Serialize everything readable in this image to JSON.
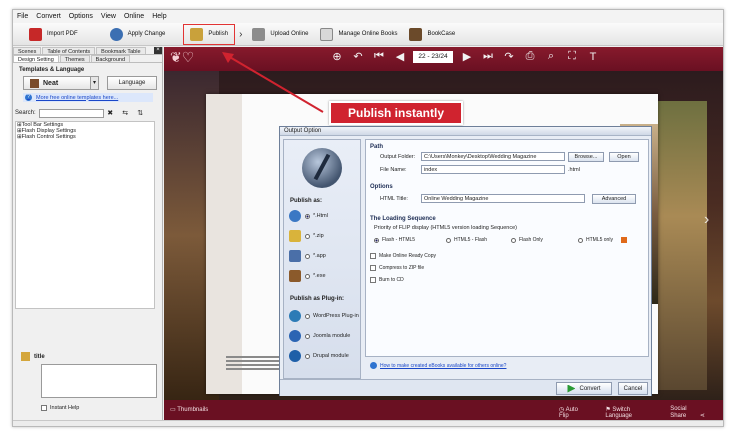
{
  "menu": [
    "File",
    "Convert",
    "Options",
    "View",
    "Online",
    "Help"
  ],
  "toolbar": {
    "import_pdf": "Import PDF",
    "apply_change": "Apply Change",
    "publish": "Publish",
    "upload_online": "Upload Online",
    "manage_online_books": "Manage Online Books",
    "bookcase": "BookCase"
  },
  "left_panel": {
    "tabs_top": [
      "Scenes",
      "Table of Contents",
      "Bookmark Table"
    ],
    "tabs_bottom": [
      "Design Setting",
      "Themes",
      "Background"
    ],
    "section_title": "Templates & Language",
    "template_name": "Neat",
    "language_button": "Language",
    "more_templates_link": "More free online templates here...",
    "search_label": "Search:",
    "settings": [
      "Tool Bar Settings",
      "Flash Display Settings",
      "Flash Control Settings"
    ],
    "help_title": "title",
    "instant_help_label": "Instant Help"
  },
  "viewer": {
    "page_indicator": "22 - 23/24",
    "thumbnails_label": "Thumbnails",
    "auto_flip_label": "Auto Flip",
    "switch_language_label": "Switch Language",
    "social_share_label": "Social Share"
  },
  "dialog": {
    "title": "Output Option",
    "publish_as_heading": "Publish as:",
    "publish_as_options": [
      "*.Html",
      "*.zip",
      "*.app",
      "*.exe"
    ],
    "plugin_heading": "Publish as Plug-in:",
    "plugin_options": [
      "WordPress Plug-in",
      "Joomla module",
      "Drupal module"
    ],
    "path_heading": "Path",
    "output_folder_label": "Output Folder:",
    "output_folder_value": "C:\\Users\\Monkey\\Desktop\\Wedding Magazine",
    "browse_button": "Browse...",
    "open_button": "Open",
    "file_name_label": "File Name:",
    "file_name_value": "index",
    "file_ext": ".html",
    "options_heading": "Options",
    "html_title_label": "HTML Title:",
    "html_title_value": "Online Wedding Magazine",
    "advanced_button": "Advanced",
    "sequence_heading": "The Loading Sequence",
    "sequence_sub": "Priority of FLIP display (HTML5 version loading Sequence)",
    "sequence_options": [
      "Flash - HTML5",
      "HTML5 - Flash",
      "Flash Only",
      "HTML5 only"
    ],
    "check_options": [
      "Make Online Ready Copy",
      "Compress to ZIP file",
      "Burn to CD"
    ],
    "help_link": "How to make created eBooks available for others online?",
    "convert_button": "Convert",
    "cancel_button": "Cancel"
  },
  "callout": "Publish instantly",
  "colors": {
    "viewer_red": "#871a2c",
    "callout_red": "#d0232f",
    "dialog_bg": "#e8edf5"
  }
}
